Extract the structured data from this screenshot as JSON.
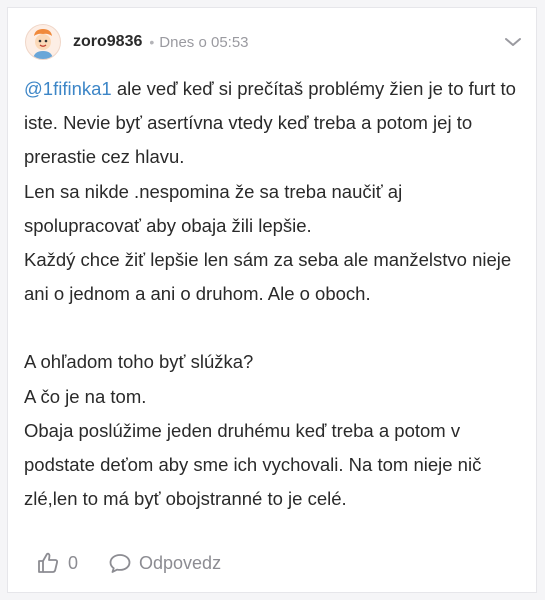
{
  "post": {
    "author": "zoro9836",
    "separator": "•",
    "timestamp": "Dnes o 05:53",
    "mention": "@1fifinka1",
    "lines_para1": [
      " ale veď keď si prečítaš problémy žien je to furt to iste. Nevie byť asertívna vtedy keď treba a potom jej to prerastie cez hlavu.",
      "Len sa nikde .nespomina že sa treba naučiť aj spolupracovať aby obaja žili lepšie.",
      "Každý chce žiť lepšie len sám za seba ale manželstvo nieje ani o jednom a ani o druhom. Ale o oboch."
    ],
    "lines_para2": [
      "A ohľadom toho byť slúžka?",
      "A čo je na tom.",
      "Obaja poslúžime jeden druhému keď treba a potom v podstate deťom aby sme ich vychovali. Na tom nieje nič zlé,len to má byť obojstranné to je celé."
    ]
  },
  "footer": {
    "like_count": "0",
    "reply_label": "Odpovedz"
  },
  "icons": {
    "like": "thumbs-up-icon",
    "reply": "speech-bubble-icon",
    "menu": "chevron-down-icon"
  },
  "colors": {
    "mention": "#3d86c7",
    "muted": "#9a9aa0",
    "text": "#2a2a2a"
  }
}
